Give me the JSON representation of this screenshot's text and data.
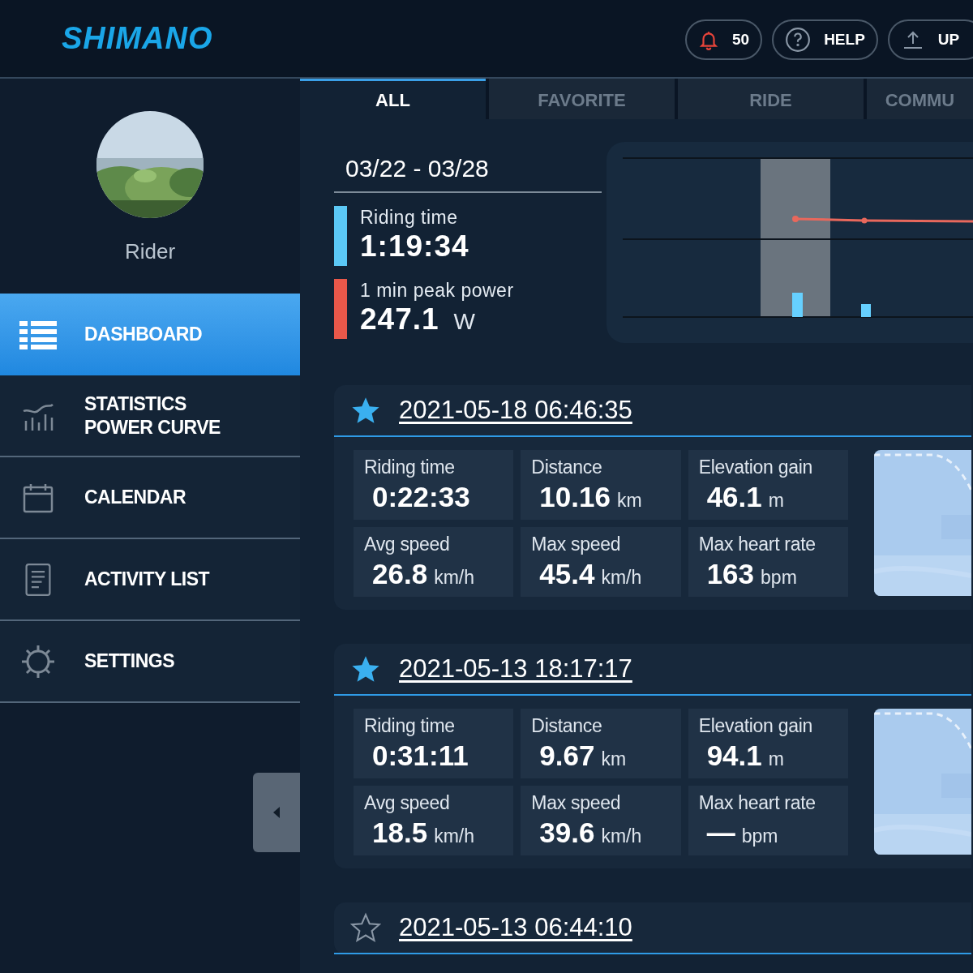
{
  "header": {
    "logo": "SHIMANO",
    "buttons": [
      {
        "kind": "notifications",
        "label": "50"
      },
      {
        "kind": "help",
        "label": "HELP"
      },
      {
        "kind": "upload",
        "label": "UP"
      }
    ]
  },
  "sidebar": {
    "user": {
      "name": "Rider"
    },
    "items": [
      {
        "label": "DASHBOARD",
        "selected": true
      },
      {
        "label": "STATISTICS POWER CURVE",
        "selected": false
      },
      {
        "label": "CALENDAR",
        "selected": false
      },
      {
        "label": "ACTIVITY LIST",
        "selected": false
      },
      {
        "label": "SETTINGS",
        "selected": false
      }
    ]
  },
  "tabs": [
    {
      "label": "ALL",
      "selected": true
    },
    {
      "label": "FAVORITE",
      "selected": false
    },
    {
      "label": "RIDE",
      "selected": false
    },
    {
      "label": "COMMU",
      "selected": false
    }
  ],
  "summary": {
    "period": "03/22 - 03/28",
    "metrics": [
      {
        "label": "Riding time",
        "value": "1:19:34",
        "color": "#5bc8f5"
      },
      {
        "label": "1 min peak power",
        "value": "247.1",
        "unit": "W",
        "color": "#e8584a"
      }
    ]
  },
  "activities": [
    {
      "favorite": true,
      "date": "2021-05-18 06:46:35",
      "stats": [
        {
          "label": "Riding time",
          "value": "0:22:33"
        },
        {
          "label": "Distance",
          "value": "10.16",
          "unit": "km"
        },
        {
          "label": "Elevation gain",
          "value": "46.1",
          "unit": "m"
        },
        {
          "label": "Avg speed",
          "value": "26.8",
          "unit": "km/h"
        },
        {
          "label": "Max speed",
          "value": "45.4",
          "unit": "km/h"
        },
        {
          "label": "Max heart rate",
          "value": "163",
          "unit": "bpm"
        }
      ]
    },
    {
      "favorite": true,
      "date": "2021-05-13 18:17:17",
      "stats": [
        {
          "label": "Riding time",
          "value": "0:31:11"
        },
        {
          "label": "Distance",
          "value": "9.67",
          "unit": "km"
        },
        {
          "label": "Elevation gain",
          "value": "94.1",
          "unit": "m"
        },
        {
          "label": "Avg speed",
          "value": "18.5",
          "unit": "km/h"
        },
        {
          "label": "Max speed",
          "value": "39.6",
          "unit": "km/h"
        },
        {
          "label": "Max heart rate",
          "value": "—",
          "unit": "bpm"
        }
      ]
    },
    {
      "favorite": false,
      "date": "2021-05-13 06:44:10"
    }
  ]
}
